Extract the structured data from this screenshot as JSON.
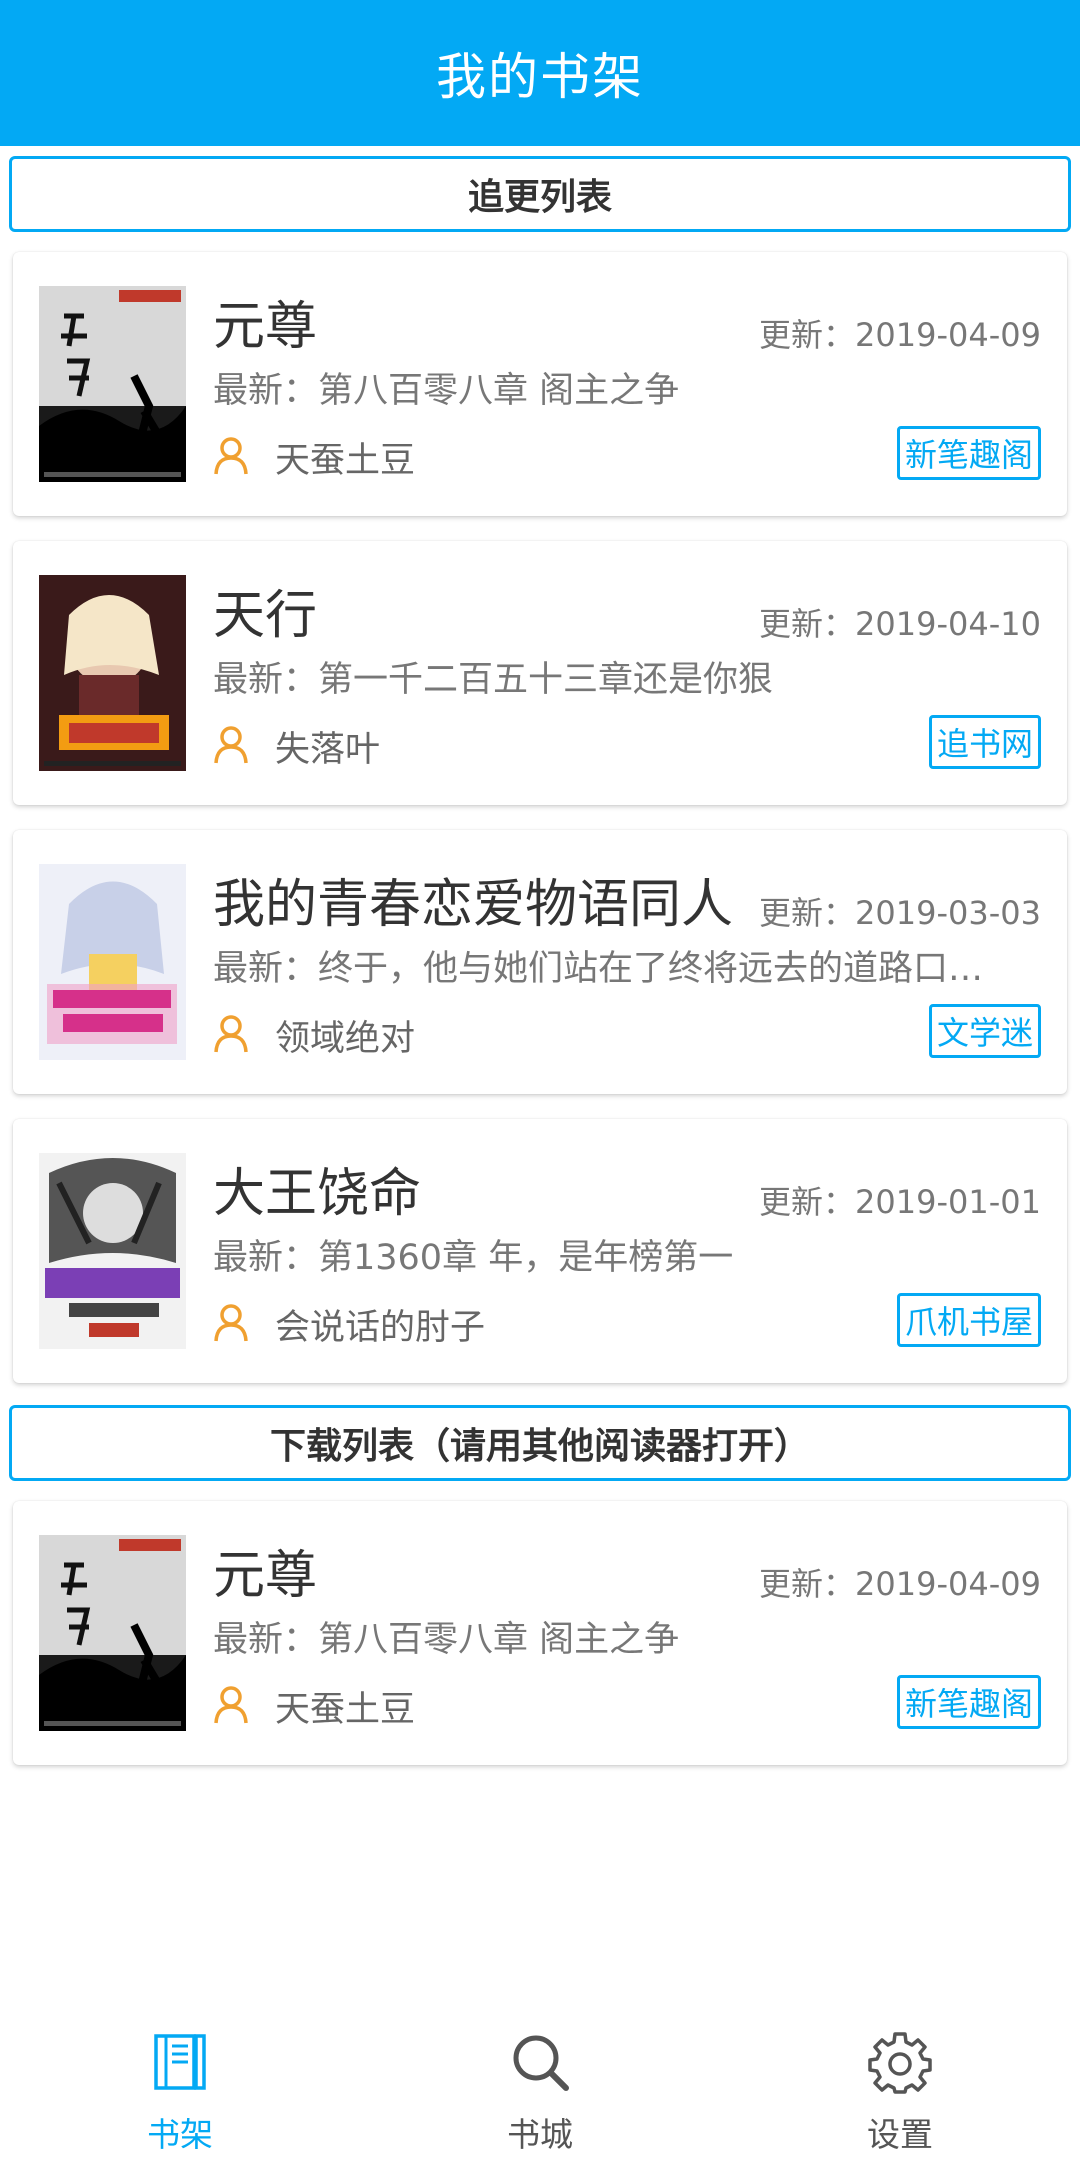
{
  "header": {
    "title": "我的书架"
  },
  "sections": {
    "following_label": "追更列表",
    "download_label": "下载列表（请用其他阅读器打开）"
  },
  "following_books": [
    {
      "title": "元尊",
      "update": "更新：2019-04-09",
      "latest": "最新：第八百零八章 阁主之争",
      "author": "天蚕土豆",
      "source": "新笔趣阁"
    },
    {
      "title": "天行",
      "update": "更新：2019-04-10",
      "latest": "最新：第一千二百五十三章还是你狠",
      "author": "失落叶",
      "source": "追书网"
    },
    {
      "title": "我的青春恋爱物语同人",
      "update": "更新：2019-03-03",
      "latest": "最新：终于，他与她们站在了终将远去的道路口…",
      "author": "领域绝对",
      "source": "文学迷"
    },
    {
      "title": "大王饶命",
      "update": "更新：2019-01-01",
      "latest": "最新：第1360章 年，是年榜第一",
      "author": "会说话的肘子",
      "source": "爪机书屋"
    }
  ],
  "download_books": [
    {
      "title": "元尊",
      "update": "更新：2019-04-09",
      "latest": "最新：第八百零八章 阁主之争",
      "author": "天蚕土豆",
      "source": "新笔趣阁"
    }
  ],
  "bottom_nav": {
    "bookshelf": "书架",
    "bookstore": "书城",
    "settings": "设置"
  },
  "colors": {
    "accent": "#03a9f4",
    "author_icon": "#f0a030"
  },
  "icons": {
    "author": "person-icon",
    "bookshelf": "bookshelf-icon",
    "bookstore": "search-icon",
    "settings": "gear-icon"
  }
}
